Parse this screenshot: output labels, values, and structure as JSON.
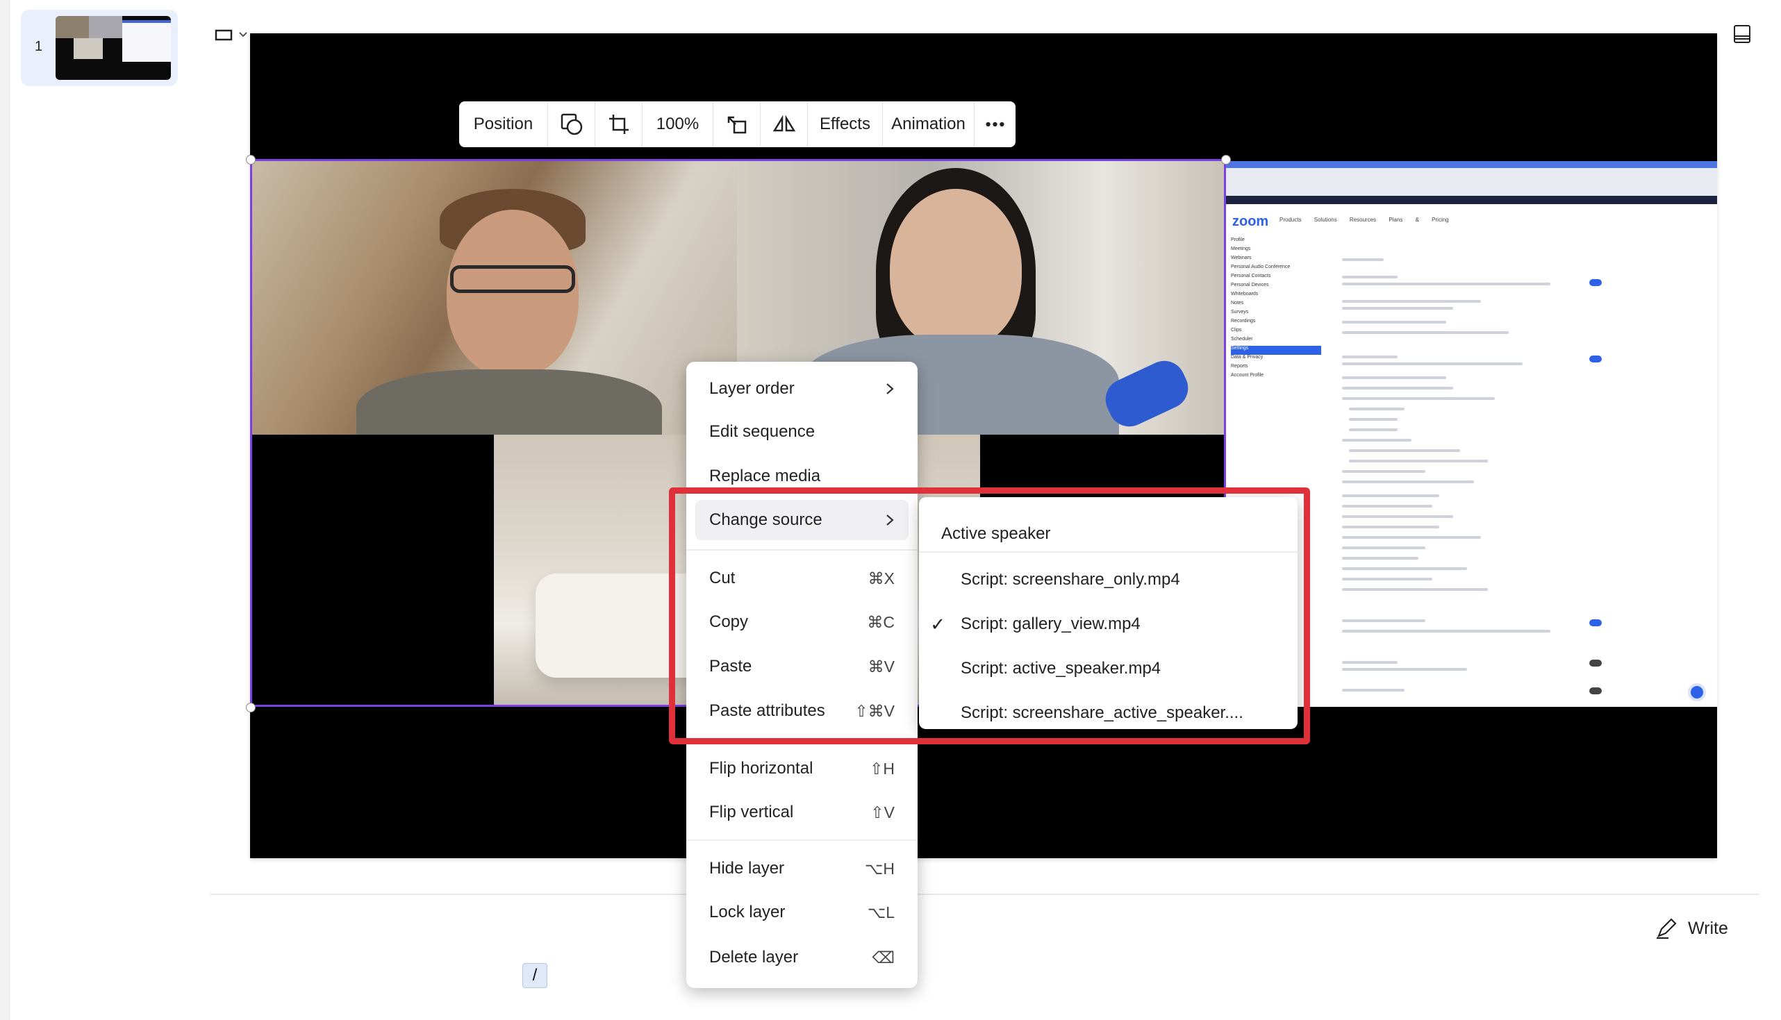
{
  "sidebar": {
    "slide_number": "1"
  },
  "toolbar": {
    "position_label": "Position",
    "zoom_label": "100%",
    "effects_label": "Effects",
    "animation_label": "Animation"
  },
  "share_screen": {
    "logo": "zoom",
    "nav": "Products Solutions Resources Plans & Pricing",
    "side_items": [
      "Profile",
      "Meetings",
      "Webinars",
      "Personal Audio Conference",
      "Personal Contacts",
      "Personal Devices",
      "Whiteboards",
      "Notes",
      "Surveys",
      "Recordings",
      "Clips",
      "Scheduler",
      "Settings",
      "Data & Privacy",
      "Reports",
      "Account Profile"
    ],
    "active_side_item": "Settings"
  },
  "context_menu": {
    "items": [
      {
        "label": "Layer order",
        "shortcut": ""
      },
      {
        "label": "Edit sequence",
        "shortcut": ""
      },
      {
        "label": "Replace media",
        "shortcut": ""
      },
      {
        "label": "Change source",
        "shortcut": ""
      },
      {
        "label": "Cut",
        "shortcut": "⌘X"
      },
      {
        "label": "Copy",
        "shortcut": "⌘C"
      },
      {
        "label": "Paste",
        "shortcut": "⌘V"
      },
      {
        "label": "Paste attributes",
        "shortcut": "⇧⌘V"
      },
      {
        "label": "Flip horizontal",
        "shortcut": "⇧H"
      },
      {
        "label": "Flip vertical",
        "shortcut": "⇧V"
      },
      {
        "label": "Hide layer",
        "shortcut": "⌥H"
      },
      {
        "label": "Lock layer",
        "shortcut": "⌥L"
      },
      {
        "label": "Delete layer",
        "shortcut": "⌫"
      }
    ]
  },
  "submenu": {
    "header": "Active speaker",
    "items": [
      {
        "label": "Script: screenshare_only.mp4",
        "checked": false
      },
      {
        "label": "Script: gallery_view.mp4",
        "checked": true
      },
      {
        "label": "Script: active_speaker.mp4",
        "checked": false
      },
      {
        "label": "Script: screenshare_active_speaker....",
        "checked": false
      }
    ]
  },
  "write_button": {
    "label": "Write"
  },
  "slash_key": "/",
  "colors": {
    "selection": "#7b3fe4",
    "highlight": "#e0313a",
    "zoom_blue": "#2d62e8"
  }
}
